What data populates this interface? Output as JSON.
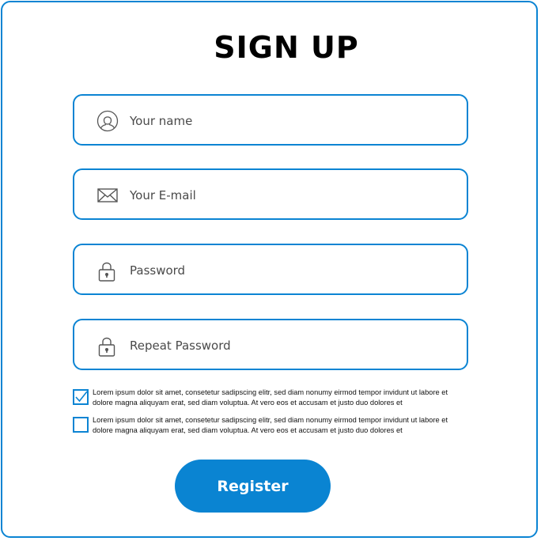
{
  "form": {
    "title": "SIGN UP",
    "fields": [
      {
        "placeholder": "Your name",
        "icon": "user-icon"
      },
      {
        "placeholder": "Your E-mail",
        "icon": "envelope-icon"
      },
      {
        "placeholder": "Password",
        "icon": "lock-icon"
      },
      {
        "placeholder": "Repeat Password",
        "icon": "lock-icon"
      }
    ],
    "consents": [
      {
        "checked": true,
        "text": "Lorem ipsum dolor sit amet, consetetur sadipscing elitr, sed diam nonumy eirmod tempor invidunt ut labore et dolore magna aliquyam erat, sed diam voluptua. At vero eos et accusam et justo duo dolores et"
      },
      {
        "checked": false,
        "text": "Lorem ipsum dolor sit amet, consetetur sadipscing elitr, sed diam nonumy eirmod tempor invidunt ut labore et dolore magna aliquyam erat, sed diam voluptua. At vero eos et accusam et justo duo dolores et"
      }
    ],
    "register_label": "Register"
  },
  "colors": {
    "accent": "#0b84d3",
    "button": "#0a84d2",
    "title": "#000000"
  }
}
